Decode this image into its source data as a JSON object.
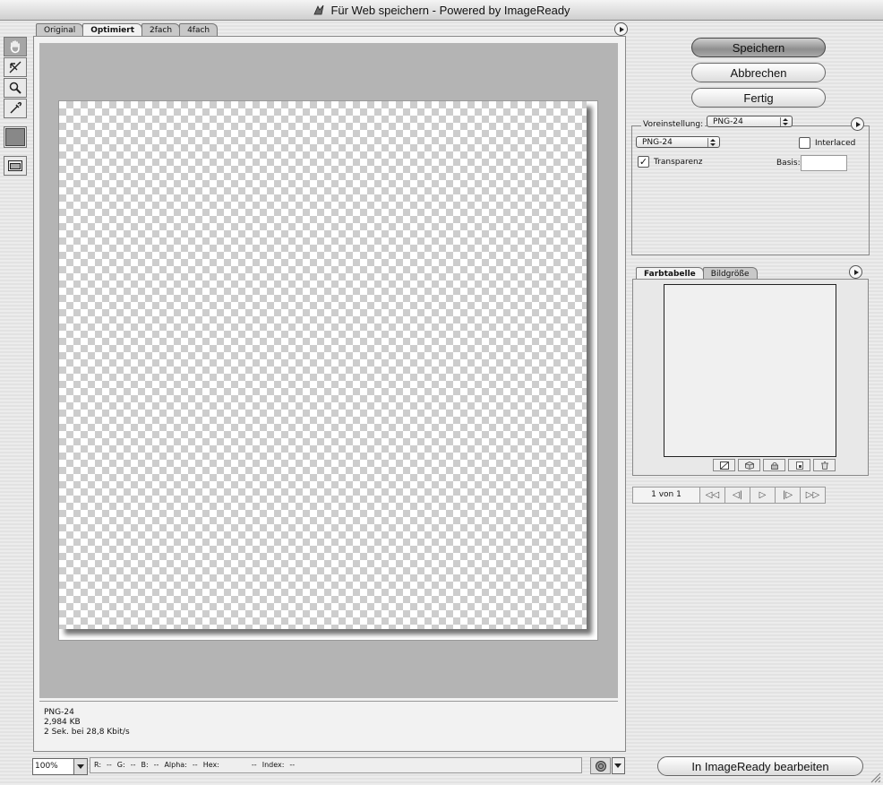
{
  "window": {
    "title": "Für Web speichern - Powered by ImageReady"
  },
  "view_tabs": [
    "Original",
    "Optimiert",
    "2fach",
    "4fach"
  ],
  "active_view_tab": "Optimiert",
  "tools": [
    "hand-tool",
    "slice-select-tool",
    "zoom-tool",
    "eyedropper-tool",
    "eyedropper-color",
    "preview-toggle"
  ],
  "image_info": {
    "format": "PNG-24",
    "size": "2,984 KB",
    "download": "2 Sek. bei 28,8 Kbit/s"
  },
  "status": {
    "zoom": "100%",
    "r_label": "R:",
    "r_val": "--",
    "g_label": "G:",
    "g_val": "--",
    "b_label": "B:",
    "b_val": "--",
    "alpha_label": "Alpha:",
    "alpha_val": "--",
    "hex_label": "Hex:",
    "hex_val": "--",
    "index_label": "Index:",
    "index_val": "--"
  },
  "buttons": {
    "save": "Speichern",
    "cancel": "Abbrechen",
    "done": "Fertig",
    "edit_imageready": "In ImageReady bearbeiten"
  },
  "settings": {
    "preset_label": "Voreinstellung:",
    "preset_value": "PNG-24",
    "format_value": "PNG-24",
    "interlaced_label": "Interlaced",
    "interlaced_checked": false,
    "transparency_label": "Transparenz",
    "transparency_checked": true,
    "matte_label": "Basis:"
  },
  "color_table": {
    "tabs": [
      "Farbtabelle",
      "Bildgröße"
    ],
    "active_tab": "Farbtabelle"
  },
  "animation": {
    "frame_label": "1 von 1",
    "controls": [
      "◁◁",
      "◁|",
      "▷",
      "|▷",
      "▷▷"
    ]
  }
}
